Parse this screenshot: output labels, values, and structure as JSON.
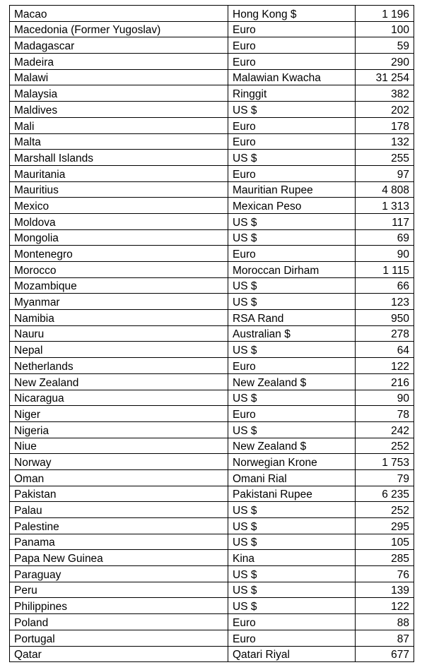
{
  "table": {
    "rows": [
      [
        "Macao",
        "Hong Kong $",
        "1 196"
      ],
      [
        "Macedonia (Former Yugoslav)",
        "Euro",
        "100"
      ],
      [
        "Madagascar",
        "Euro",
        "59"
      ],
      [
        "Madeira",
        "Euro",
        "290"
      ],
      [
        "Malawi",
        "Malawian Kwacha",
        "31 254"
      ],
      [
        "Malaysia",
        "Ringgit",
        "382"
      ],
      [
        "Maldives",
        "US $",
        "202"
      ],
      [
        "Mali",
        "Euro",
        "178"
      ],
      [
        "Malta",
        "Euro",
        "132"
      ],
      [
        "Marshall Islands",
        "US $",
        "255"
      ],
      [
        "Mauritania",
        "Euro",
        "97"
      ],
      [
        "Mauritius",
        "Mauritian Rupee",
        "4 808"
      ],
      [
        "Mexico",
        "Mexican Peso",
        "1 313"
      ],
      [
        "Moldova",
        "US $",
        "117"
      ],
      [
        "Mongolia",
        "US $",
        "69"
      ],
      [
        "Montenegro",
        "Euro",
        "90"
      ],
      [
        "Morocco",
        "Moroccan Dirham",
        "1 115"
      ],
      [
        "Mozambique",
        "US $",
        "66"
      ],
      [
        "Myanmar",
        "US $",
        "123"
      ],
      [
        "Namibia",
        "RSA Rand",
        "950"
      ],
      [
        "Nauru",
        "Australian $",
        "278"
      ],
      [
        "Nepal",
        "US $",
        "64"
      ],
      [
        "Netherlands",
        "Euro",
        "122"
      ],
      [
        "New Zealand",
        "New Zealand $",
        "216"
      ],
      [
        "Nicaragua",
        "US $",
        "90"
      ],
      [
        "Niger",
        "Euro",
        "78"
      ],
      [
        "Nigeria",
        "US $",
        "242"
      ],
      [
        "Niue",
        "New Zealand $",
        "252"
      ],
      [
        "Norway",
        "Norwegian Krone",
        "1 753"
      ],
      [
        "Oman",
        "Omani Rial",
        "79"
      ],
      [
        "Pakistan",
        "Pakistani Rupee",
        "6 235"
      ],
      [
        "Palau",
        "US $",
        "252"
      ],
      [
        "Palestine",
        "US $",
        "295"
      ],
      [
        "Panama",
        "US $",
        "105"
      ],
      [
        "Papa New Guinea",
        "Kina",
        "285"
      ],
      [
        "Paraguay",
        "US $",
        "76"
      ],
      [
        "Peru",
        "US $",
        "139"
      ],
      [
        "Philippines",
        "US $",
        "122"
      ],
      [
        "Poland",
        "Euro",
        "88"
      ],
      [
        "Portugal",
        "Euro",
        "87"
      ],
      [
        "Qatar",
        "Qatari Riyal",
        "677"
      ]
    ]
  }
}
